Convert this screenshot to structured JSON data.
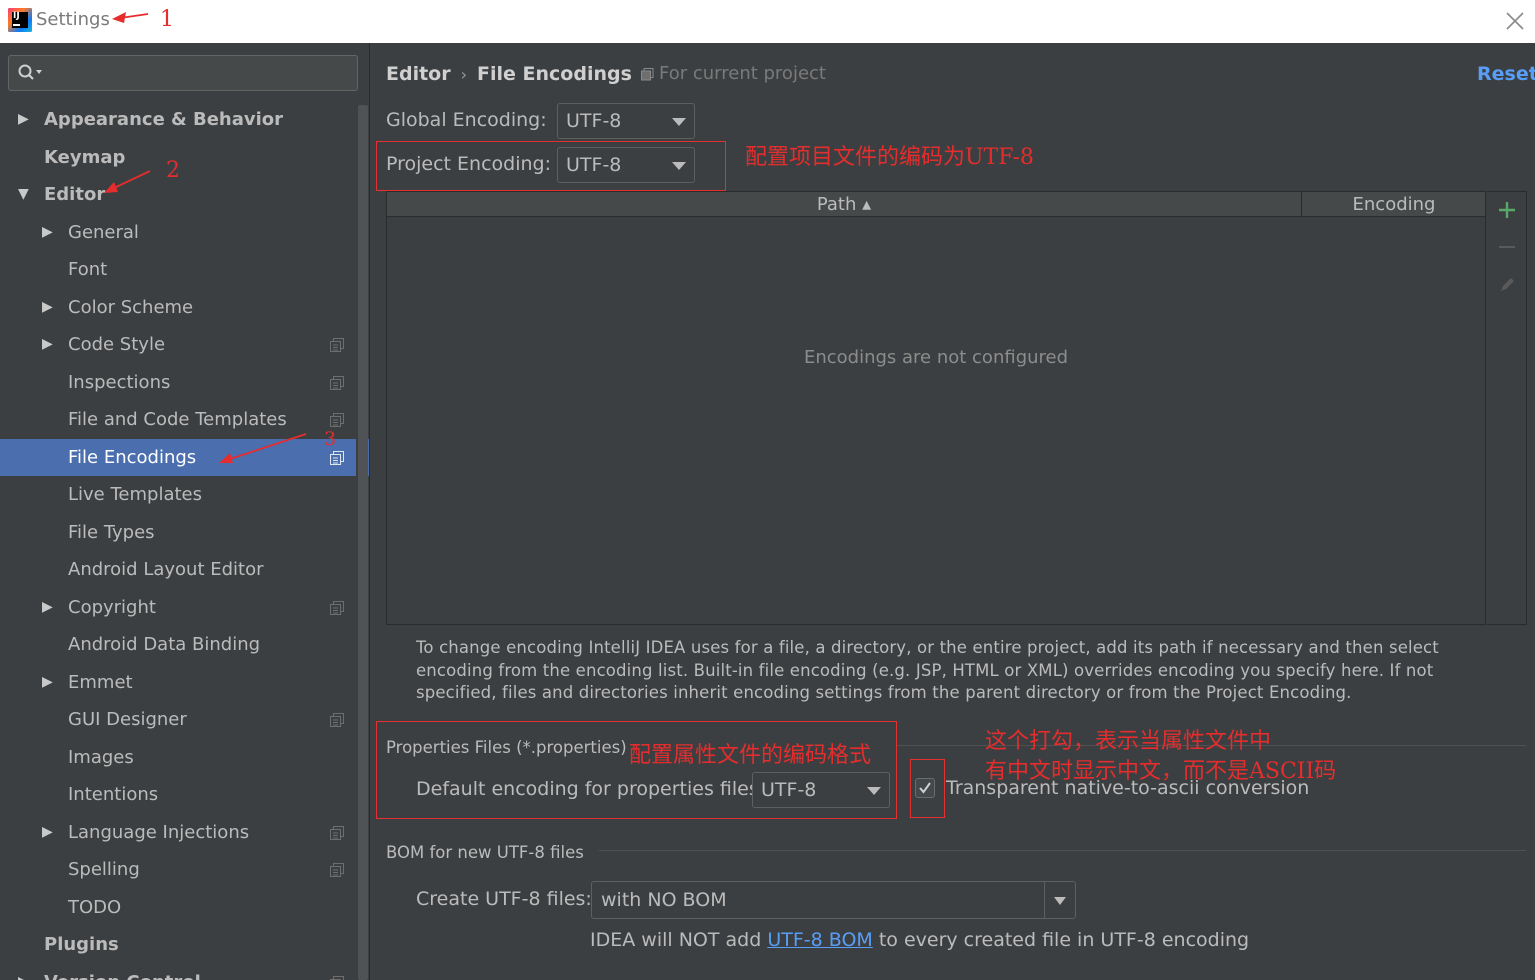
{
  "window": {
    "title": "Settings",
    "logo_letters": "IJ"
  },
  "annotations": {
    "n1": "1",
    "n2": "2",
    "n3": "3",
    "project_encoding": "配置项目文件的编码为UTF-8",
    "properties_encoding": "配置属性文件的编码格式",
    "checkbox_line1": "这个打勾，表示当属性文件中",
    "checkbox_line2": "有中文时显示中文，而不是ASCII码"
  },
  "sidebar": {
    "search_placeholder": "",
    "items": [
      {
        "label": "Appearance & Behavior",
        "level": 0,
        "arrow": "▶",
        "bold": true
      },
      {
        "label": "Keymap",
        "level": 0,
        "arrow": "",
        "bold": true
      },
      {
        "label": "Editor",
        "level": 0,
        "arrow": "▼",
        "bold": true
      },
      {
        "label": "General",
        "level": 1,
        "arrow": "▶"
      },
      {
        "label": "Font",
        "level": 1,
        "arrow": ""
      },
      {
        "label": "Color Scheme",
        "level": 1,
        "arrow": "▶"
      },
      {
        "label": "Code Style",
        "level": 1,
        "arrow": "▶",
        "copy": true
      },
      {
        "label": "Inspections",
        "level": 1,
        "arrow": "",
        "copy": true
      },
      {
        "label": "File and Code Templates",
        "level": 1,
        "arrow": "",
        "copy": true
      },
      {
        "label": "File Encodings",
        "level": 1,
        "arrow": "",
        "copy": true,
        "selected": true
      },
      {
        "label": "Live Templates",
        "level": 1,
        "arrow": ""
      },
      {
        "label": "File Types",
        "level": 1,
        "arrow": ""
      },
      {
        "label": "Android Layout Editor",
        "level": 1,
        "arrow": ""
      },
      {
        "label": "Copyright",
        "level": 1,
        "arrow": "▶",
        "copy": true
      },
      {
        "label": "Android Data Binding",
        "level": 1,
        "arrow": ""
      },
      {
        "label": "Emmet",
        "level": 1,
        "arrow": "▶"
      },
      {
        "label": "GUI Designer",
        "level": 1,
        "arrow": "",
        "copy": true
      },
      {
        "label": "Images",
        "level": 1,
        "arrow": ""
      },
      {
        "label": "Intentions",
        "level": 1,
        "arrow": ""
      },
      {
        "label": "Language Injections",
        "level": 1,
        "arrow": "▶",
        "copy": true
      },
      {
        "label": "Spelling",
        "level": 1,
        "arrow": "",
        "copy": true
      },
      {
        "label": "TODO",
        "level": 1,
        "arrow": ""
      },
      {
        "label": "Plugins",
        "level": 0,
        "arrow": "",
        "bold": true
      },
      {
        "label": "Version Control",
        "level": 0,
        "arrow": "▶",
        "bold": true,
        "copy": true
      }
    ]
  },
  "header": {
    "crumb_parent": "Editor",
    "crumb_separator": "›",
    "crumb_current": "File Encodings",
    "scope": "For current project",
    "reset": "Reset"
  },
  "encodings": {
    "global_label": "Global Encoding:",
    "global_value": "UTF-8",
    "project_label": "Project Encoding:",
    "project_value": "UTF-8"
  },
  "table": {
    "col_path": "Path ▴",
    "col_encoding": "Encoding",
    "empty": "Encodings are not configured"
  },
  "help": "To change encoding IntelliJ IDEA uses for a file, a directory, or the entire project, add its path if necessary and then select encoding from the encoding list. Built-in file encoding (e.g. JSP, HTML or XML) overrides encoding you specify here. If not specified, files and directories inherit encoding settings from the parent directory or from the Project Encoding.",
  "properties": {
    "section": "Properties Files (*.properties)",
    "default_label": "Default encoding for properties files:",
    "default_value": "UTF-8",
    "transparent_label": "Transparent native-to-ascii conversion",
    "transparent_checked": true
  },
  "bom": {
    "section": "BOM for new UTF-8 files",
    "create_label": "Create UTF-8 files:",
    "create_value": "with NO BOM",
    "note_prefix": "IDEA will NOT add ",
    "note_link": "UTF-8 BOM",
    "note_suffix": " to every created file in UTF-8 encoding"
  },
  "colors": {
    "background": "#3c3f41",
    "selection": "#4b6eaf",
    "link": "#589df6",
    "annotation": "#e52d2d",
    "add_green": "#59a869"
  }
}
